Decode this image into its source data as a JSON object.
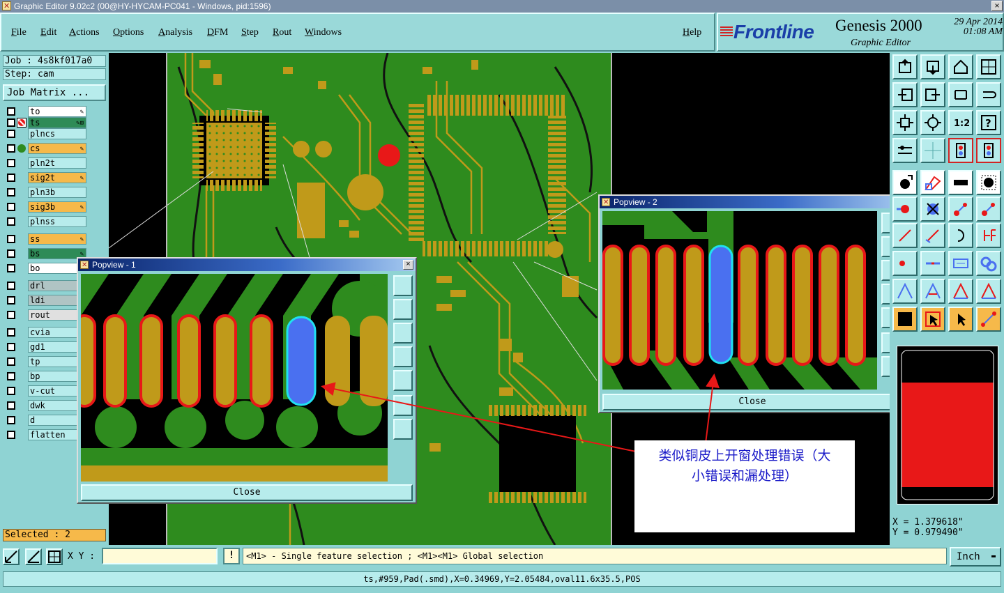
{
  "window": {
    "title": "Graphic Editor 9.02c2 (00@HY-HYCAM-PC041 - Windows, pid:1596)",
    "close": "×"
  },
  "menu": {
    "file": "File",
    "edit": "Edit",
    "actions": "Actions",
    "options": "Options",
    "analysis": "Analysis",
    "dfm": "DFM",
    "step": "Step",
    "rout": "Rout",
    "windows": "Windows",
    "help": "Help"
  },
  "brand": {
    "logo": "Frontline",
    "product": "Genesis 2000",
    "subtitle": "Graphic Editor",
    "date": "29 Apr 2014",
    "time": "01:08 AM"
  },
  "job": {
    "job_line": "Job : 4s8kf017a0",
    "step_line": "Step: cam",
    "matrix_button": "Job Matrix ..."
  },
  "layers": [
    {
      "name": "to",
      "color": "#ffffff",
      "status": "",
      "edit": "✎"
    },
    {
      "name": "ts",
      "color": "#2e8b57",
      "status": "work",
      "edit": "✎⊞"
    },
    {
      "name": "plncs",
      "color": "#b7ecec",
      "status": "",
      "edit": ""
    },
    {
      "name": "cs",
      "color": "#f6b94a",
      "status": "display",
      "edit": "✎"
    },
    {
      "name": "pln2t",
      "color": "#b7ecec",
      "status": "",
      "edit": ""
    },
    {
      "name": "sig2t",
      "color": "#f6b94a",
      "status": "",
      "edit": "✎"
    },
    {
      "name": "pln3b",
      "color": "#b7ecec",
      "status": "",
      "edit": ""
    },
    {
      "name": "sig3b",
      "color": "#f6b94a",
      "status": "",
      "edit": "✎"
    },
    {
      "name": "plnss",
      "color": "#b7ecec",
      "status": "",
      "edit": ""
    },
    {
      "name": "ss",
      "color": "#f6b94a",
      "status": "",
      "edit": "✎"
    },
    {
      "name": "bs",
      "color": "#2e8b57",
      "status": "",
      "edit": "✎"
    },
    {
      "name": "bo",
      "color": "#ffffff",
      "status": "",
      "edit": ""
    },
    {
      "name": "drl",
      "color": "#b0c4c4",
      "status": "",
      "edit": ""
    },
    {
      "name": "ldi",
      "color": "#b0c4c4",
      "status": "",
      "edit": ""
    },
    {
      "name": "rout",
      "color": "#e0e0e0",
      "status": "",
      "edit": ""
    },
    {
      "name": "cvia",
      "color": "#b7ecec",
      "status": "",
      "edit": ""
    },
    {
      "name": "gd1",
      "color": "#b7ecec",
      "status": "",
      "edit": ""
    },
    {
      "name": "tp",
      "color": "#b7ecec",
      "status": "",
      "edit": ""
    },
    {
      "name": "bp",
      "color": "#b7ecec",
      "status": "",
      "edit": ""
    },
    {
      "name": "v-cut",
      "color": "#b7ecec",
      "status": "",
      "edit": ""
    },
    {
      "name": "dwk",
      "color": "#b7ecec",
      "status": "",
      "edit": ""
    },
    {
      "name": "d",
      "color": "#b7ecec",
      "status": "",
      "edit": ""
    },
    {
      "name": "flatten",
      "color": "#b7ecec",
      "status": "",
      "edit": ""
    }
  ],
  "selected_label": "Selected : 2",
  "coords": {
    "x_line": "X = 1.379618\"",
    "y_line": "Y = 0.979490\""
  },
  "popview1": {
    "title": "Popview - 1",
    "close_button": "Close",
    "close_x": "×"
  },
  "popview2": {
    "title": "Popview - 2",
    "close_button": "Close",
    "close_x": "×"
  },
  "annotation": {
    "line1": "类似铜皮上开窗处理错误（大",
    "line2": "小错误和漏处理）"
  },
  "bottom": {
    "xy_label": "X Y :",
    "xy_value": "",
    "warn": "!",
    "prompt": "<M1> - Single feature selection ; <M1><M1> Global selection",
    "unit": "Inch"
  },
  "status": "ts,#959,Pad(.smd),X=0.34969,Y=2.05484,oval11.6x35.5,POS",
  "colors": {
    "board_green": "#2e8b1e",
    "pad_gold": "#c09a1a",
    "error_red": "#e81818",
    "highlight_blue": "#4a70f0",
    "ui_teal": "#8fd3d3"
  }
}
